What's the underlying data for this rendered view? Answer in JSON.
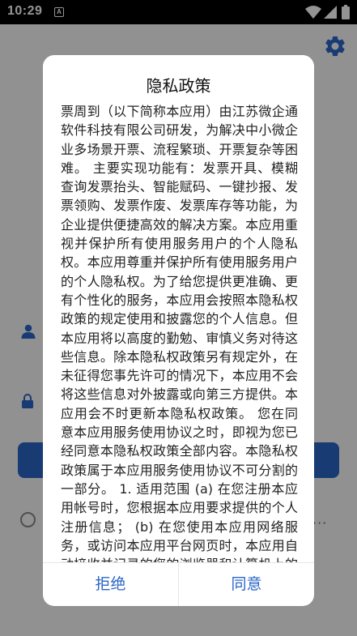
{
  "status_bar": {
    "time": "10:29",
    "notification_icon": "A"
  },
  "background": {
    "settings_icon": "gear-icon",
    "username_label": "账",
    "password_label": "密",
    "login_button": "",
    "more": "···"
  },
  "dialog": {
    "title": "隐私政策",
    "body": "票周到（以下简称本应用）由江苏微企通软件科技有限公司研发，为解决中小微企业多场景开票、流程繁琐、开票复杂等困难。 主要实现功能有：发票开具、模糊查询发票抬头、智能赋码、一键抄报、发票领购、发票作废、发票库存等功能，为企业提供便捷高效的解决方案。本应用重视并保护所有使用服务用户的个人隐私权。本应用尊重并保护所有使用服务用户的个人隐私权。为了给您提供更准确、更有个性化的服务，本应用会按照本隐私权政策的规定使用和披露您的个人信息。但本应用将以高度的勤勉、审慎义务对待这些信息。除本隐私权政策另有规定外，在未征得您事先许可的情况下，本应用不会将这些信息对外披露或向第三方提供。本应用会不时更新本隐私权政策。 您在同意本应用服务使用协议之时，即视为您已经同意本隐私权政策全部内容。本隐私权政策属于本应用服务使用协议不可分割的一部分。 1. 适用范围 (a) 在您注册本应用帐号时，您根据本应用要求提供的个人注册信息； (b) 在您使用本应用网络服务，或访问本应用平台网页时，本应用自动接收并记录的您的浏览器和计算机上的信息，包括但不限于您的IP地址、浏览器的类型、使用的语言、访问日期和时间、软硬件特征信息及您需求的网页记录等数据；",
    "reject_button": "拒绝",
    "agree_button": "同意"
  },
  "colors": {
    "accent": "#2a66c9",
    "overlay": "rgba(0,0,0,0.42)"
  }
}
